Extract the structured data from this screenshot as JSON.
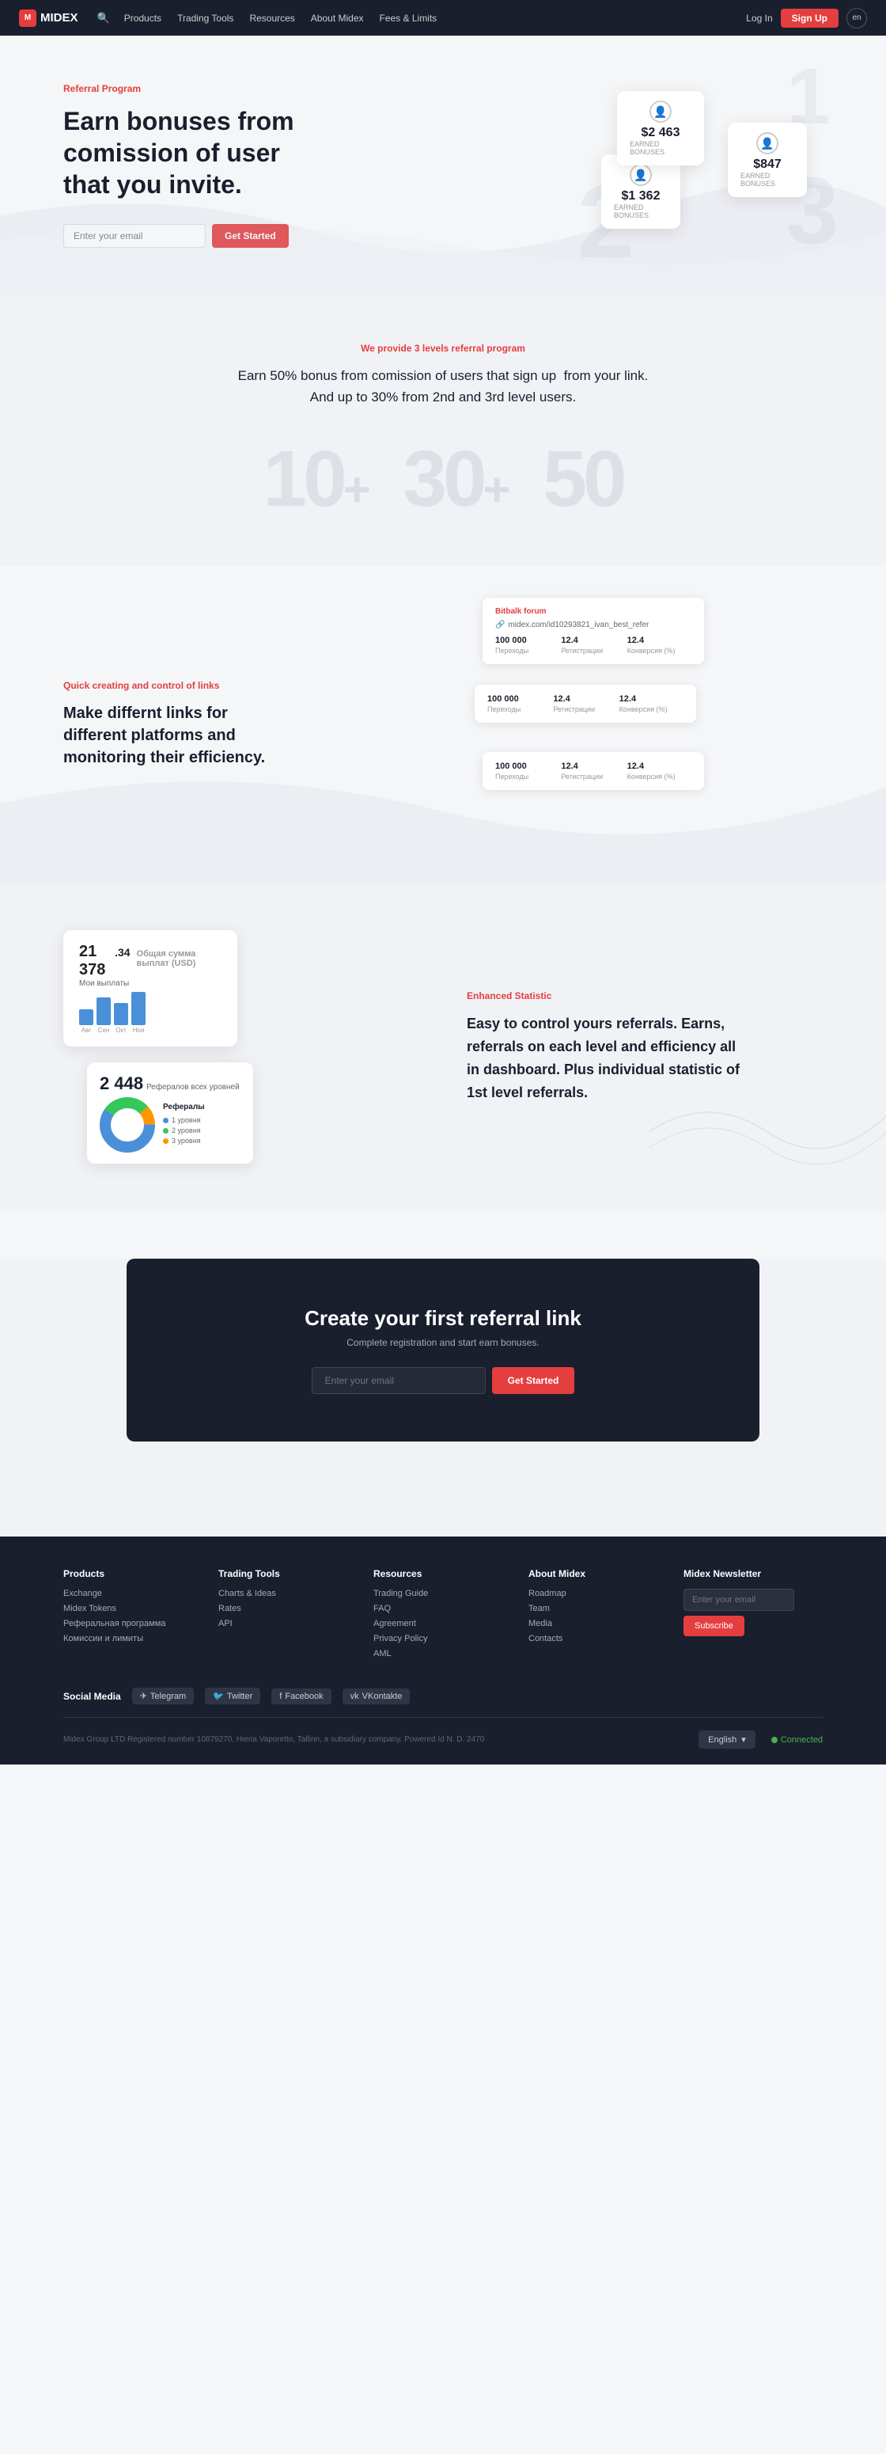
{
  "navbar": {
    "logo": "MIDEX",
    "search_icon": "🔍",
    "links": [
      {
        "label": "Products",
        "id": "products"
      },
      {
        "label": "Trading Tools",
        "id": "trading-tools"
      },
      {
        "label": "Resources",
        "id": "resources"
      },
      {
        "label": "About Midex",
        "id": "about-midex"
      },
      {
        "label": "Fees & Limits",
        "id": "fees-limits"
      }
    ],
    "login_label": "Log In",
    "signup_label": "Sign Up",
    "lang": "en"
  },
  "hero": {
    "tag": "Referral Program",
    "title": "Earn bonuses from comission of user that you invite.",
    "email_placeholder": "Enter your email",
    "cta_button": "Get Started",
    "cards": [
      {
        "amount": "$2 463",
        "label": "EARNED BONUSES",
        "pos": "1"
      },
      {
        "amount": "$1 362",
        "label": "EARNED BONUSES",
        "pos": "2"
      },
      {
        "amount": "$847",
        "label": "EARNED BONUSES",
        "pos": "3"
      }
    ]
  },
  "levels_section": {
    "tag": "We provide 3 levels referral program",
    "description": "Earn 50% bonus from comission of users that sign up  from your link.\nAnd up to 30% from 2nd and 3rd level users.",
    "numbers": "10+  30+  50"
  },
  "links_section": {
    "tag": "Quick creating and control of links",
    "description": "Make differnt links for different platforms and monitoring their efficiency.",
    "demo_card_title": "Bitbalk forum",
    "demo_url": "midex.com/id10293821_ivan_best_refer",
    "table_headers": [
      "Переходы",
      "Регистрации",
      "Конверсия (%)"
    ],
    "table_rows": [
      [
        "100 000",
        "12.4",
        "12.4"
      ],
      [
        "100 000",
        "12.4",
        "12.4"
      ],
      [
        "100 000",
        "12.4",
        "12.4"
      ]
    ]
  },
  "stats_section": {
    "tag": "Enhanced Statistic",
    "description": "Easy to control yours referrals. Earns, referrals on each level and efficiency all in dashboard. Plus individual statistic of 1st level referrals.",
    "total_label": "21 378",
    "total_decimal": ".34",
    "total_desc": "Общая сумма выплат (USD)",
    "my_payments": "Мои выплаты",
    "bar_months": [
      "Авг",
      "Сен",
      "Окт",
      "Ноя"
    ],
    "referrals_count": "2 448",
    "referrals_label": "Рефералов всех уровней",
    "pie_title": "Рефералы",
    "pie_legend": [
      "1 уровня",
      "2 уровня",
      "3 уровня"
    ]
  },
  "cta": {
    "title": "Create your first referral link",
    "subtitle": "Complete registration and start earn bonuses.",
    "email_placeholder": "Enter your email",
    "button": "Get Started"
  },
  "footer": {
    "columns": [
      {
        "title": "Products",
        "links": [
          "Exchange",
          "Midex Tokens",
          "Реферальная программа",
          "Комиссии и лимиты"
        ]
      },
      {
        "title": "Trading Tools",
        "links": [
          "Charts & Ideas",
          "Rates",
          "API"
        ]
      },
      {
        "title": "Resources",
        "links": [
          "Trading Guide",
          "FAQ",
          "Agreement",
          "Privacy Policy",
          "AML"
        ]
      },
      {
        "title": "About Midex",
        "links": [
          "Roadmap",
          "Team",
          "Media",
          "Contacts"
        ]
      },
      {
        "title": "Midex Newsletter",
        "email_placeholder": "Enter your email",
        "subscribe_btn": "Subscribe"
      }
    ],
    "social": {
      "label": "Social Media",
      "items": [
        "Telegram",
        "Twitter",
        "Facebook",
        "VKontakte"
      ]
    },
    "lang": "English",
    "connected": "Connected",
    "copyright": "Midex Group LTD Registered number 10879270, Hieria Vaporetto, Tallinn, a subsidiary company. Powered Id N. D. 2470"
  }
}
